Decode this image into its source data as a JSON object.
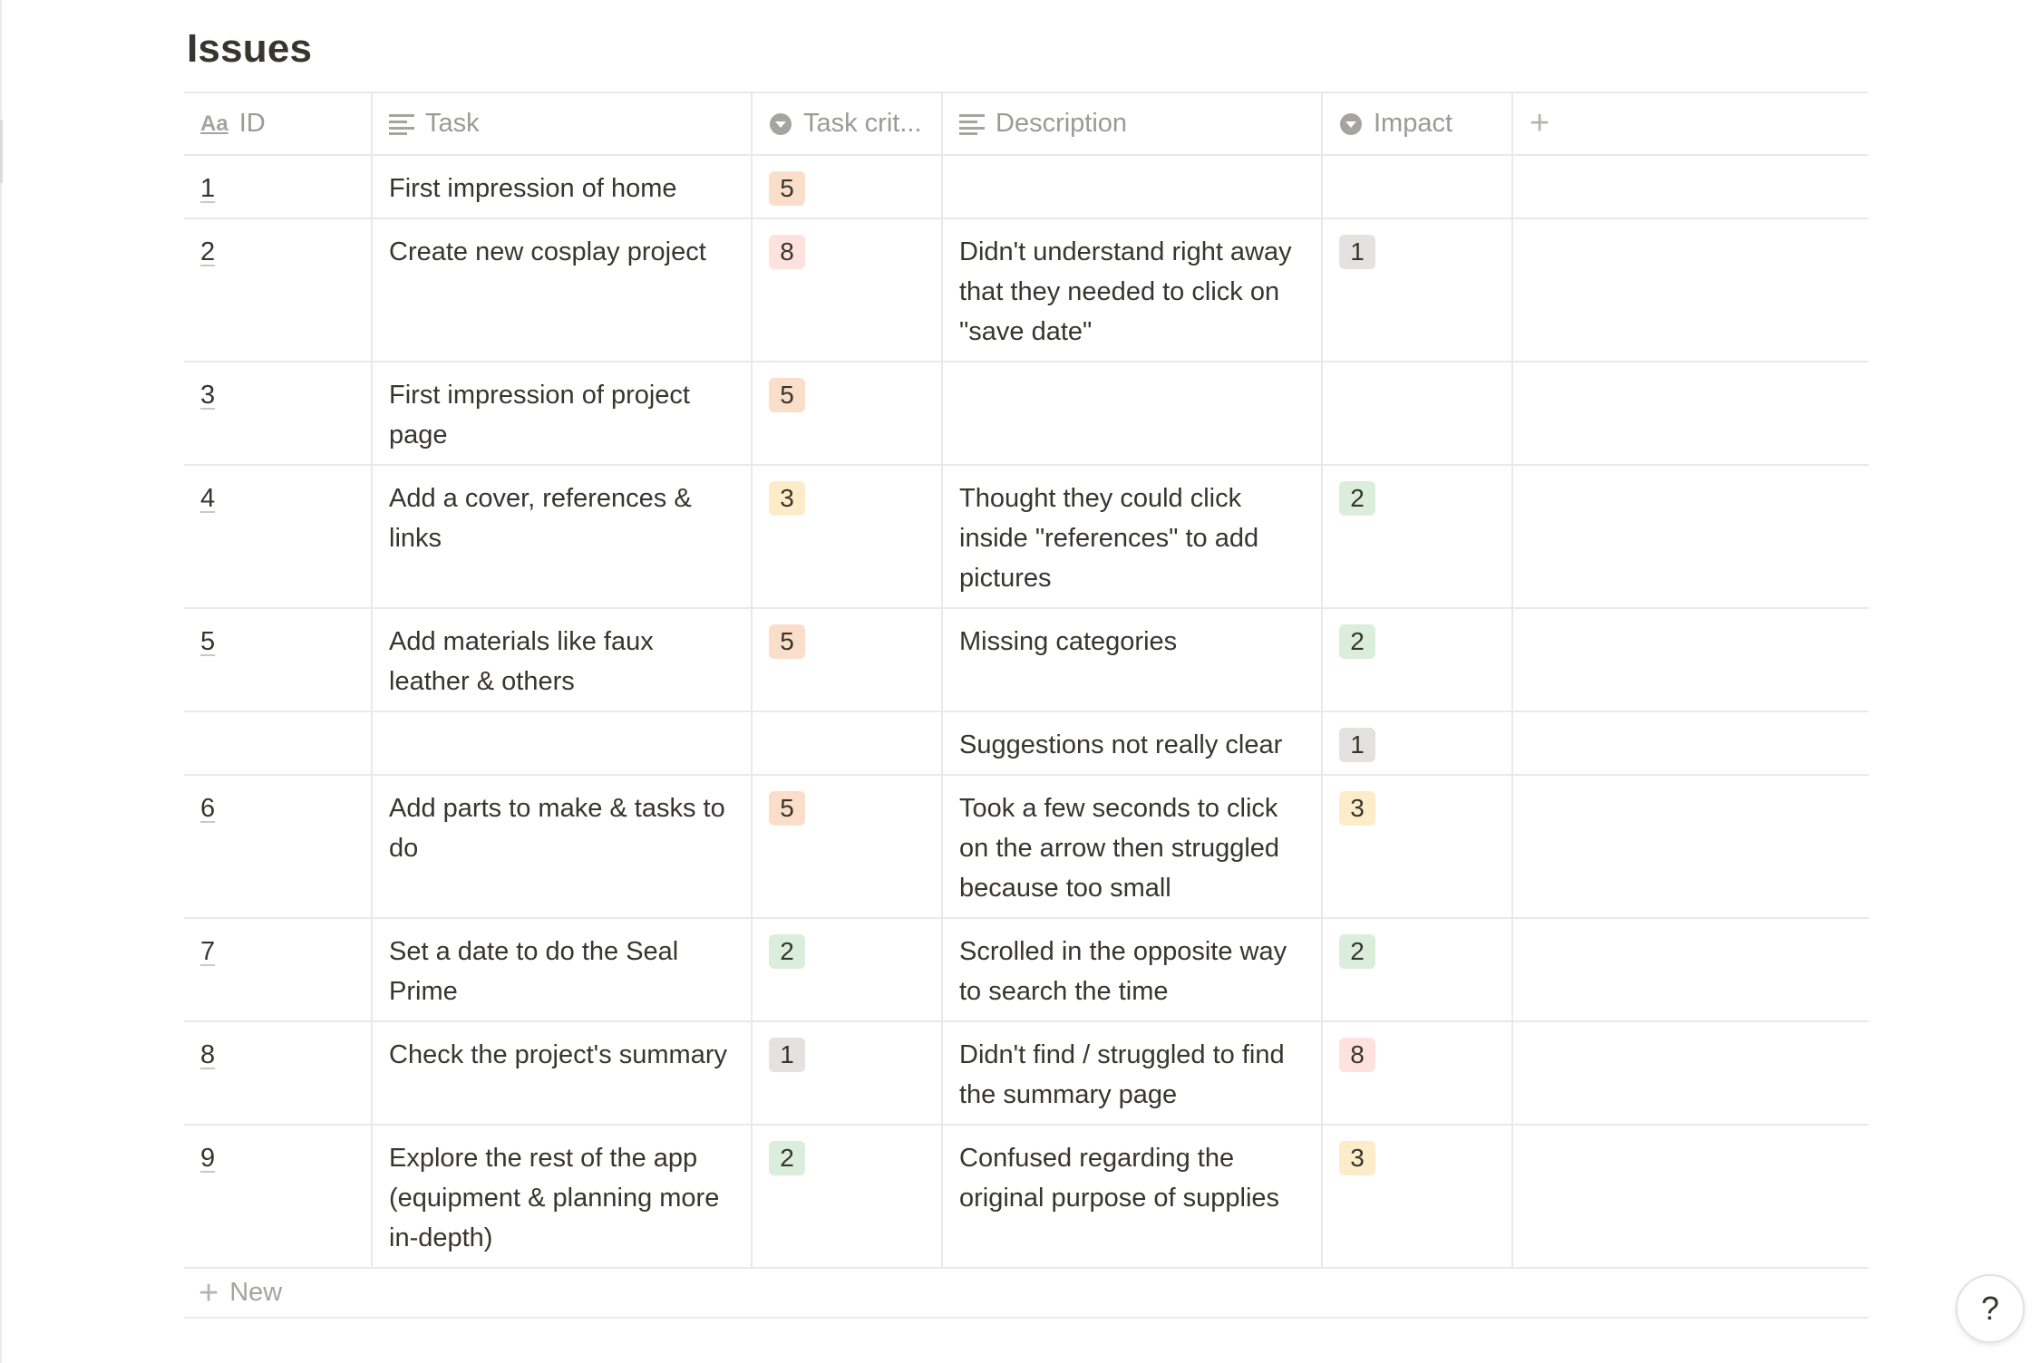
{
  "page": {
    "title": "Issues"
  },
  "columns": [
    {
      "key": "id",
      "label": "ID",
      "icon": "title-aa-icon"
    },
    {
      "key": "task",
      "label": "Task",
      "icon": "text-lines-icon"
    },
    {
      "key": "crit",
      "label": "Task crit...",
      "icon": "select-chevron-icon"
    },
    {
      "key": "desc",
      "label": "Description",
      "icon": "text-lines-icon"
    },
    {
      "key": "impact",
      "label": "Impact",
      "icon": "select-chevron-icon"
    },
    {
      "key": "add",
      "label": "+",
      "icon": "plus-icon"
    }
  ],
  "tag_colors": {
    "1": "#e3e2e0",
    "2": "#dbeddb",
    "3": "#fdecc8",
    "5": "#fadec9",
    "8": "#ffe2dd"
  },
  "rows": [
    {
      "id": "1",
      "task": "First impression of home",
      "crit": "5",
      "desc": "",
      "impact": ""
    },
    {
      "id": "2",
      "task": "Create new cosplay project",
      "crit": "8",
      "desc": "Didn't understand right away that they needed to click on \"save date\"",
      "impact": "1"
    },
    {
      "id": "3",
      "task": "First impression of project page",
      "crit": "5",
      "desc": "",
      "impact": ""
    },
    {
      "id": "4",
      "task": "Add a cover, references & links",
      "crit": "3",
      "desc": "Thought they could click inside \"references\" to add pictures",
      "impact": "2"
    },
    {
      "id": "5",
      "task": "Add materials like faux leather & others",
      "crit": "5",
      "desc": "Missing categories",
      "impact": "2"
    },
    {
      "id": "",
      "task": "",
      "crit": "",
      "desc": "Suggestions not really clear",
      "impact": "1"
    },
    {
      "id": "6",
      "task": "Add parts to make & tasks to do",
      "crit": "5",
      "desc": "Took a few seconds to click on the arrow then struggled because too small",
      "impact": "3"
    },
    {
      "id": "7",
      "task": "Set a date to do the Seal Prime",
      "crit": "2",
      "desc": "Scrolled in the opposite way to search the time",
      "impact": "2"
    },
    {
      "id": "8",
      "task": "Check the project's summary",
      "crit": "1",
      "desc": "Didn't find / struggled to find the summary page",
      "impact": "8"
    },
    {
      "id": "9",
      "task": "Explore the rest of the app (equipment & planning more in-depth)",
      "crit": "2",
      "desc": "Confused regarding the original purpose of supplies",
      "impact": "3"
    }
  ],
  "footer": {
    "new_label": "New"
  },
  "help": {
    "label": "?"
  }
}
